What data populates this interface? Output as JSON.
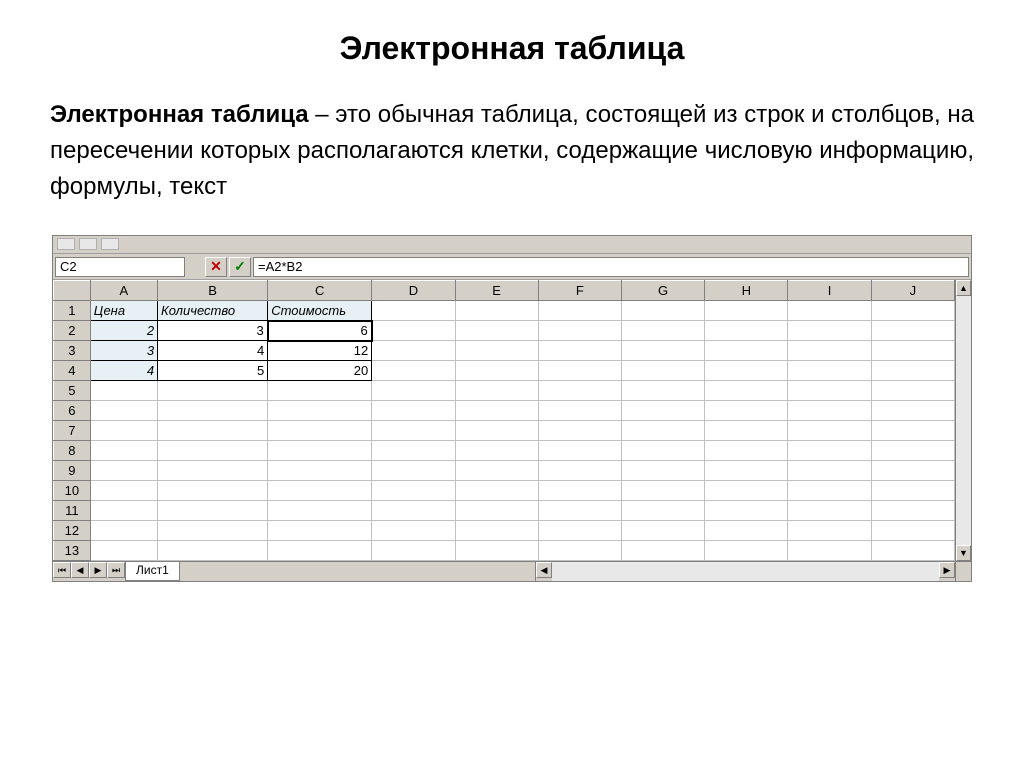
{
  "page_title": "Электронная таблица",
  "definition_term": "Электронная таблица",
  "definition_text": " – это обычная таблица, состоящей из строк и столбцов, на пересечении которых располагаются клетки, содержащие числовую информацию, формулы, текст",
  "name_box": "C2",
  "formula": "=A2*B2",
  "columns": [
    "A",
    "B",
    "C",
    "D",
    "E",
    "F",
    "G",
    "H",
    "I",
    "J"
  ],
  "row_numbers": [
    "1",
    "2",
    "3",
    "4",
    "5",
    "6",
    "7",
    "8",
    "9",
    "10",
    "11",
    "12",
    "13"
  ],
  "headers": {
    "a": "Цена",
    "b": "Количество",
    "c": "Стоимость"
  },
  "rows": [
    {
      "a": "2",
      "b": "3",
      "c": "6"
    },
    {
      "a": "3",
      "b": "4",
      "c": "12"
    },
    {
      "a": "4",
      "b": "5",
      "c": "20"
    }
  ],
  "sheet_tab": "Лист1",
  "icons": {
    "cancel": "✕",
    "accept": "✓",
    "up": "▲",
    "down": "▼",
    "left": "◀",
    "right": "▶",
    "first": "⏮",
    "prev": "◀",
    "next": "▶",
    "last": "⏭"
  }
}
